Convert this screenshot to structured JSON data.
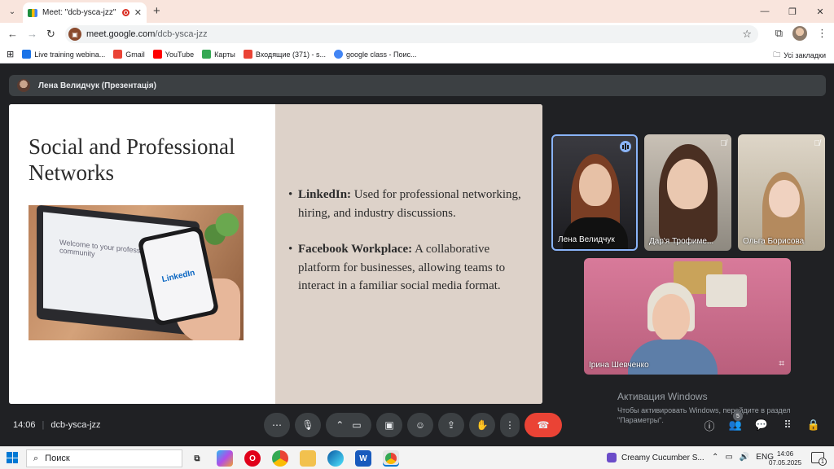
{
  "browser": {
    "tab_title": "Meet: \"dcb-ysca-jzz\"",
    "new_tab_symbol": "+",
    "url_host": "meet.google.com",
    "url_path": "/dcb-ysca-jzz",
    "window_controls": [
      "—",
      "❐",
      "✕"
    ]
  },
  "bookmarks": {
    "items": [
      {
        "label": "Live training webina...",
        "color": "#1a73e8"
      },
      {
        "label": "Gmail",
        "color": "#ea4335"
      },
      {
        "label": "YouTube",
        "color": "#ff0000"
      },
      {
        "label": "Карты",
        "color": "#34a853"
      },
      {
        "label": "Входящие (371) - s...",
        "color": "#ea4335"
      },
      {
        "label": "google class - Поис...",
        "color": "#4285f4"
      }
    ],
    "all_bookmarks": "Усі закладки"
  },
  "meet": {
    "presenter": "Лена Велидчук (Презентація)",
    "time": "14:06",
    "meeting_code": "dcb-ysca-jzz",
    "people_count": "5"
  },
  "slide": {
    "title_line1": "Social and Professional",
    "title_line2": "Networks",
    "photo_caption": "Welcome to your professional community",
    "phone_logo": "LinkedIn",
    "bullets": [
      {
        "term": "LinkedIn:",
        "text": " Used for professional networking, hiring, and industry discussions."
      },
      {
        "term": "Facebook Workplace:",
        "text": " A collaborative platform for businesses, allowing teams to interact in a familiar social media format."
      }
    ]
  },
  "participants": [
    {
      "name": "Лена Велидчук",
      "state": "speaking"
    },
    {
      "name": "Дар'я Трофиме...",
      "state": "muted"
    },
    {
      "name": "Ольга Борисова",
      "state": "muted"
    },
    {
      "name": "Ірина Шевченко",
      "state": "pinned"
    }
  ],
  "activation": {
    "title": "Активация Windows",
    "subtitle": "Чтобы активировать Windows, перейдите в раздел \"Параметры\"."
  },
  "taskbar": {
    "search_placeholder": "Поиск",
    "media_title": "Creamy Cucumber S...",
    "language": "ENG",
    "clock_time": "14:06",
    "clock_date": "07.05.2025",
    "notifications": "1"
  },
  "colors": {
    "meet_bg": "#202124",
    "end_call": "#ea4335",
    "slide_right_bg": "#ddd2c9",
    "tab_strip": "#f9e5dd"
  }
}
